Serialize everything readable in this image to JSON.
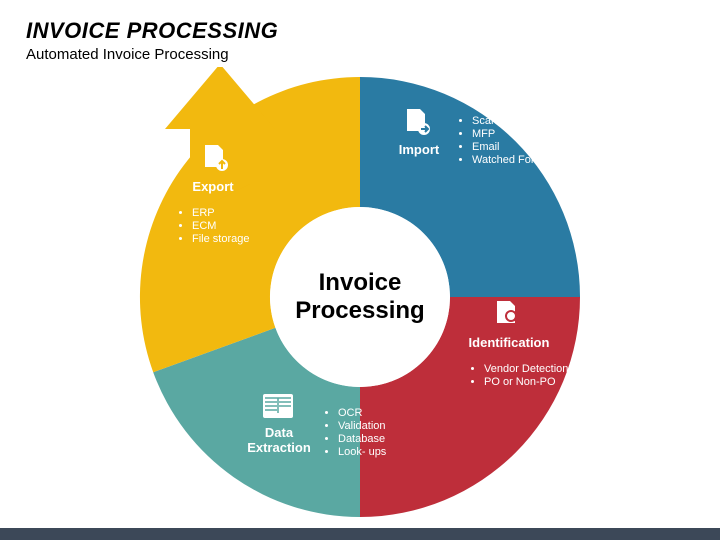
{
  "header": {
    "title": "INVOICE PROCESSING",
    "subtitle": "Automated Invoice Processing"
  },
  "center": {
    "line1": "Invoice",
    "line2": "Processing"
  },
  "segments": {
    "import": {
      "label": "Import",
      "color": "#2a7ba3",
      "icon": "file-right-icon",
      "items": [
        "Scanner",
        "MFP",
        "Email",
        "Watched Folder"
      ]
    },
    "identification": {
      "label": "Identification",
      "color": "#be2e3a",
      "icon": "file-search-icon",
      "items": [
        "Vendor Detection",
        "PO or Non-PO"
      ]
    },
    "extraction": {
      "label": "Data Extraction",
      "color": "#5aa8a2",
      "icon": "form-icon",
      "items": [
        "OCR",
        "Validation",
        "Database",
        "Look- ups"
      ]
    },
    "export": {
      "label": "Export",
      "color": "#f2b90f",
      "icon": "file-up-icon",
      "items": [
        "ERP",
        "ECM",
        "File storage"
      ]
    }
  }
}
